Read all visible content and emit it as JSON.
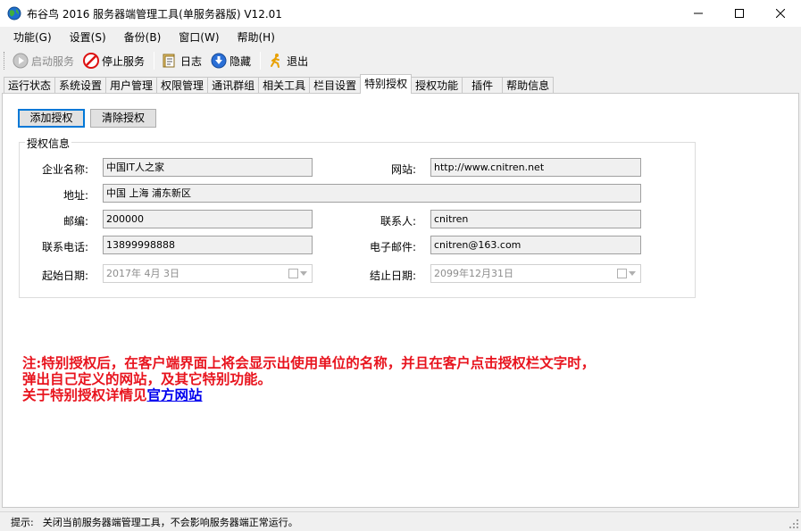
{
  "window": {
    "title": "布谷鸟 2016 服务器端管理工具(单服务器版)  V12.01",
    "icon": "globe-icon"
  },
  "menu": {
    "items": [
      {
        "label": "功能(G)"
      },
      {
        "label": "设置(S)"
      },
      {
        "label": "备份(B)"
      },
      {
        "label": "窗口(W)"
      },
      {
        "label": "帮助(H)"
      }
    ]
  },
  "toolbar": {
    "start_label": "启动服务",
    "stop_label": "停止服务",
    "log_label": "日志",
    "hide_label": "隐藏",
    "exit_label": "退出"
  },
  "tabs": [
    {
      "label": "运行状态"
    },
    {
      "label": "系统设置"
    },
    {
      "label": "用户管理"
    },
    {
      "label": "权限管理"
    },
    {
      "label": "通讯群组"
    },
    {
      "label": "相关工具"
    },
    {
      "label": "栏目设置"
    },
    {
      "label": "特别授权",
      "active": true
    },
    {
      "label": "授权功能"
    },
    {
      "label": "插件"
    },
    {
      "label": "帮助信息"
    }
  ],
  "auth": {
    "add_button": "添加授权",
    "clear_button": "清除授权",
    "group_title": "授权信息",
    "company_label": "企业名称:",
    "company_value": "中国IT人之家",
    "website_label": "网站:",
    "website_value": "http://www.cnitren.net",
    "address_label": "地址:",
    "address_value": "中国 上海 浦东新区",
    "zip_label": "邮编:",
    "zip_value": "200000",
    "contact_label": "联系人:",
    "contact_value": "cnitren",
    "phone_label": "联系电话:",
    "phone_value": "13899998888",
    "email_label": "电子邮件:",
    "email_value": "cnitren@163.com",
    "start_date_label": "起始日期:",
    "start_date_value": "2017年  4月  3日",
    "end_date_label": "结止日期:",
    "end_date_value": "2099年12月31日"
  },
  "note": {
    "line1": "注:特别授权后，在客户端界面上将会显示出使用单位的名称，并且在客户点击授权栏文字时，",
    "line2": "弹出自己定义的网站，及其它特别功能。",
    "line3_prefix": "关于特别授权详情见",
    "link_text": "官方网站"
  },
  "status": {
    "label": "提示:",
    "text": "关闭当前服务器端管理工具，不会影响服务器端正常运行。"
  },
  "colors": {
    "note_red": "#e8141e",
    "link_blue": "#0000ee",
    "focus_blue": "#0078d7"
  }
}
